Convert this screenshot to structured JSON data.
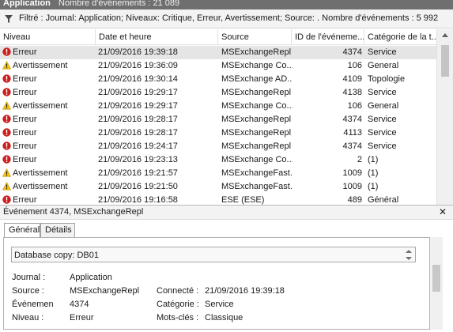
{
  "window": {
    "log_name": "Application",
    "event_count": "Nombre d'événements : 21 089"
  },
  "filter": {
    "text": "Filtré : Journal: Application; Niveaux: Critique, Erreur, Avertissement; Source: . Nombre d'événements : 5 992",
    "icon": "funnel-icon"
  },
  "grid": {
    "columns": [
      "Niveau",
      "Date et heure",
      "Source",
      "ID de l'événeme...",
      "Catégorie de la t..."
    ],
    "rows": [
      {
        "level": "Erreur",
        "date": "21/09/2016 19:39:18",
        "source": "MSExchangeRepl",
        "id": "4374",
        "category": "Service",
        "icon": "error-icon"
      },
      {
        "level": "Avertissement",
        "date": "21/09/2016 19:36:09",
        "source": "MSExchange Co...",
        "id": "106",
        "category": "General",
        "icon": "warning-icon"
      },
      {
        "level": "Erreur",
        "date": "21/09/2016 19:30:14",
        "source": "MSExchange AD...",
        "id": "4109",
        "category": "Topologie",
        "icon": "error-icon"
      },
      {
        "level": "Erreur",
        "date": "21/09/2016 19:29:17",
        "source": "MSExchangeRepl",
        "id": "4138",
        "category": "Service",
        "icon": "error-icon"
      },
      {
        "level": "Avertissement",
        "date": "21/09/2016 19:29:17",
        "source": "MSExchange Co...",
        "id": "106",
        "category": "General",
        "icon": "warning-icon"
      },
      {
        "level": "Erreur",
        "date": "21/09/2016 19:28:17",
        "source": "MSExchangeRepl",
        "id": "4374",
        "category": "Service",
        "icon": "error-icon"
      },
      {
        "level": "Erreur",
        "date": "21/09/2016 19:28:17",
        "source": "MSExchangeRepl",
        "id": "4113",
        "category": "Service",
        "icon": "error-icon"
      },
      {
        "level": "Erreur",
        "date": "21/09/2016 19:24:17",
        "source": "MSExchangeRepl",
        "id": "4374",
        "category": "Service",
        "icon": "error-icon"
      },
      {
        "level": "Erreur",
        "date": "21/09/2016 19:23:13",
        "source": "MSExchange Co...",
        "id": "2",
        "category": "(1)",
        "icon": "error-icon"
      },
      {
        "level": "Avertissement",
        "date": "21/09/2016 19:21:57",
        "source": "MSExchangeFast...",
        "id": "1009",
        "category": "(1)",
        "icon": "warning-icon"
      },
      {
        "level": "Avertissement",
        "date": "21/09/2016 19:21:50",
        "source": "MSExchangeFast...",
        "id": "1009",
        "category": "(1)",
        "icon": "warning-icon"
      },
      {
        "level": "Erreur",
        "date": "21/09/2016 19:16:58",
        "source": "ESE (ESE)",
        "id": "489",
        "category": "Général",
        "icon": "error-icon"
      }
    ]
  },
  "event": {
    "header": "Événement 4374, MSExchangeRepl",
    "close": "✕",
    "tabs": [
      "Général",
      "Détails"
    ],
    "description": "Database copy: DB01",
    "labels": {
      "journal": "Journal :",
      "source": "Source :",
      "event": "Événemen",
      "level": "Niveau :",
      "logged": "Connecté :",
      "category": "Catégorie :",
      "keywords": "Mots-clés :"
    },
    "values": {
      "journal": "Application",
      "source": "MSExchangeRepl",
      "event": "4374",
      "level": "Erreur",
      "logged": "21/09/2016 19:39:18",
      "category": "Service",
      "keywords": "Classique"
    }
  },
  "colors": {
    "error": "#cc1f1f",
    "warning": "#f2c10f",
    "selection": "#e5e5e5",
    "titlebar": "#6f6f6f"
  }
}
